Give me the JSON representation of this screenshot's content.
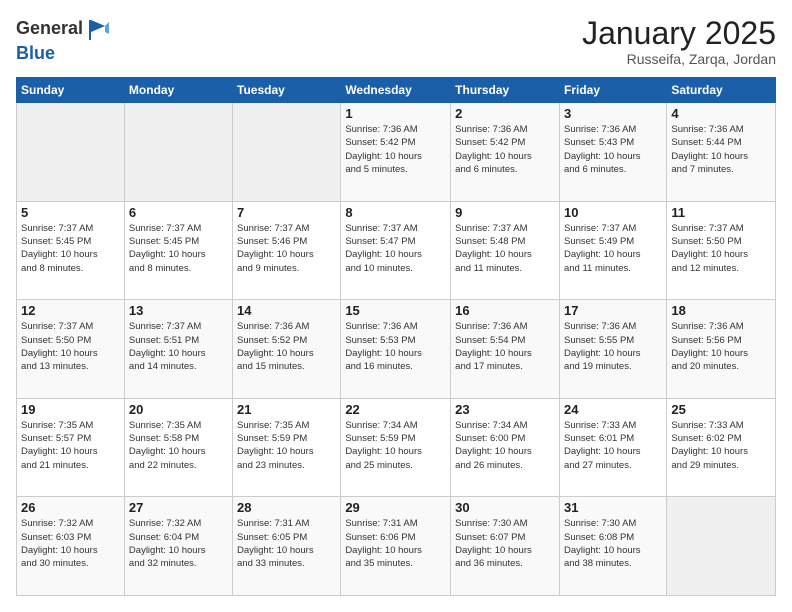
{
  "logo": {
    "general": "General",
    "blue": "Blue"
  },
  "header": {
    "month": "January 2025",
    "location": "Russeifa, Zarqa, Jordan"
  },
  "weekdays": [
    "Sunday",
    "Monday",
    "Tuesday",
    "Wednesday",
    "Thursday",
    "Friday",
    "Saturday"
  ],
  "weeks": [
    [
      {
        "day": "",
        "info": ""
      },
      {
        "day": "",
        "info": ""
      },
      {
        "day": "",
        "info": ""
      },
      {
        "day": "1",
        "info": "Sunrise: 7:36 AM\nSunset: 5:42 PM\nDaylight: 10 hours\nand 5 minutes."
      },
      {
        "day": "2",
        "info": "Sunrise: 7:36 AM\nSunset: 5:42 PM\nDaylight: 10 hours\nand 6 minutes."
      },
      {
        "day": "3",
        "info": "Sunrise: 7:36 AM\nSunset: 5:43 PM\nDaylight: 10 hours\nand 6 minutes."
      },
      {
        "day": "4",
        "info": "Sunrise: 7:36 AM\nSunset: 5:44 PM\nDaylight: 10 hours\nand 7 minutes."
      }
    ],
    [
      {
        "day": "5",
        "info": "Sunrise: 7:37 AM\nSunset: 5:45 PM\nDaylight: 10 hours\nand 8 minutes."
      },
      {
        "day": "6",
        "info": "Sunrise: 7:37 AM\nSunset: 5:45 PM\nDaylight: 10 hours\nand 8 minutes."
      },
      {
        "day": "7",
        "info": "Sunrise: 7:37 AM\nSunset: 5:46 PM\nDaylight: 10 hours\nand 9 minutes."
      },
      {
        "day": "8",
        "info": "Sunrise: 7:37 AM\nSunset: 5:47 PM\nDaylight: 10 hours\nand 10 minutes."
      },
      {
        "day": "9",
        "info": "Sunrise: 7:37 AM\nSunset: 5:48 PM\nDaylight: 10 hours\nand 11 minutes."
      },
      {
        "day": "10",
        "info": "Sunrise: 7:37 AM\nSunset: 5:49 PM\nDaylight: 10 hours\nand 11 minutes."
      },
      {
        "day": "11",
        "info": "Sunrise: 7:37 AM\nSunset: 5:50 PM\nDaylight: 10 hours\nand 12 minutes."
      }
    ],
    [
      {
        "day": "12",
        "info": "Sunrise: 7:37 AM\nSunset: 5:50 PM\nDaylight: 10 hours\nand 13 minutes."
      },
      {
        "day": "13",
        "info": "Sunrise: 7:37 AM\nSunset: 5:51 PM\nDaylight: 10 hours\nand 14 minutes."
      },
      {
        "day": "14",
        "info": "Sunrise: 7:36 AM\nSunset: 5:52 PM\nDaylight: 10 hours\nand 15 minutes."
      },
      {
        "day": "15",
        "info": "Sunrise: 7:36 AM\nSunset: 5:53 PM\nDaylight: 10 hours\nand 16 minutes."
      },
      {
        "day": "16",
        "info": "Sunrise: 7:36 AM\nSunset: 5:54 PM\nDaylight: 10 hours\nand 17 minutes."
      },
      {
        "day": "17",
        "info": "Sunrise: 7:36 AM\nSunset: 5:55 PM\nDaylight: 10 hours\nand 19 minutes."
      },
      {
        "day": "18",
        "info": "Sunrise: 7:36 AM\nSunset: 5:56 PM\nDaylight: 10 hours\nand 20 minutes."
      }
    ],
    [
      {
        "day": "19",
        "info": "Sunrise: 7:35 AM\nSunset: 5:57 PM\nDaylight: 10 hours\nand 21 minutes."
      },
      {
        "day": "20",
        "info": "Sunrise: 7:35 AM\nSunset: 5:58 PM\nDaylight: 10 hours\nand 22 minutes."
      },
      {
        "day": "21",
        "info": "Sunrise: 7:35 AM\nSunset: 5:59 PM\nDaylight: 10 hours\nand 23 minutes."
      },
      {
        "day": "22",
        "info": "Sunrise: 7:34 AM\nSunset: 5:59 PM\nDaylight: 10 hours\nand 25 minutes."
      },
      {
        "day": "23",
        "info": "Sunrise: 7:34 AM\nSunset: 6:00 PM\nDaylight: 10 hours\nand 26 minutes."
      },
      {
        "day": "24",
        "info": "Sunrise: 7:33 AM\nSunset: 6:01 PM\nDaylight: 10 hours\nand 27 minutes."
      },
      {
        "day": "25",
        "info": "Sunrise: 7:33 AM\nSunset: 6:02 PM\nDaylight: 10 hours\nand 29 minutes."
      }
    ],
    [
      {
        "day": "26",
        "info": "Sunrise: 7:32 AM\nSunset: 6:03 PM\nDaylight: 10 hours\nand 30 minutes."
      },
      {
        "day": "27",
        "info": "Sunrise: 7:32 AM\nSunset: 6:04 PM\nDaylight: 10 hours\nand 32 minutes."
      },
      {
        "day": "28",
        "info": "Sunrise: 7:31 AM\nSunset: 6:05 PM\nDaylight: 10 hours\nand 33 minutes."
      },
      {
        "day": "29",
        "info": "Sunrise: 7:31 AM\nSunset: 6:06 PM\nDaylight: 10 hours\nand 35 minutes."
      },
      {
        "day": "30",
        "info": "Sunrise: 7:30 AM\nSunset: 6:07 PM\nDaylight: 10 hours\nand 36 minutes."
      },
      {
        "day": "31",
        "info": "Sunrise: 7:30 AM\nSunset: 6:08 PM\nDaylight: 10 hours\nand 38 minutes."
      },
      {
        "day": "",
        "info": ""
      }
    ]
  ]
}
